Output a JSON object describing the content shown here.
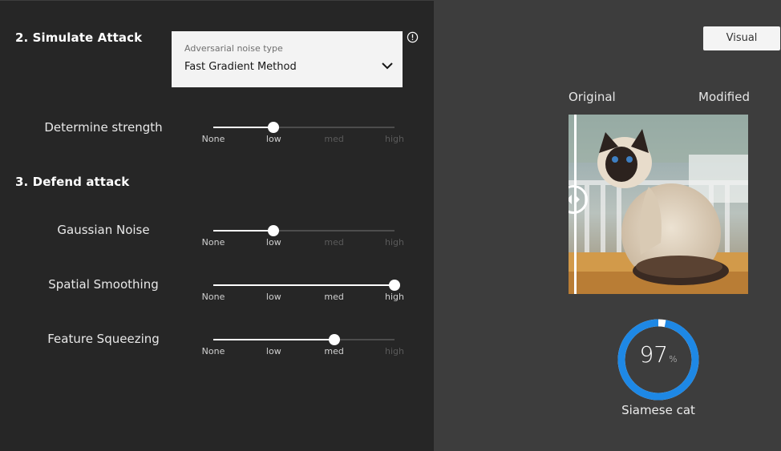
{
  "attack": {
    "title": "2. Simulate Attack",
    "noise_type": {
      "label": "Adversarial noise type",
      "value": "Fast Gradient Method"
    },
    "strength": {
      "label": "Determine strength",
      "level": 1
    }
  },
  "defend": {
    "title": "3. Defend attack",
    "gaussian_noise": {
      "label": "Gaussian Noise",
      "level": 1
    },
    "spatial_smoothing": {
      "label": "Spatial Smoothing",
      "level": 3
    },
    "feature_squeezing": {
      "label": "Feature Squeezing",
      "level": 2
    }
  },
  "slider_ticks": [
    "None",
    "low",
    "med",
    "high"
  ],
  "visual_button": "Visual",
  "comparison": {
    "original_label": "Original",
    "modified_label": "Modified"
  },
  "prediction": {
    "confidence": "97",
    "percent_sign": "%",
    "confidence_fraction": 0.97,
    "class_label": "Siamese cat"
  },
  "colors": {
    "gauge_accent": "#1e88e5",
    "panel_dark": "#262626",
    "panel_right": "#3d3d3d"
  },
  "icons": {
    "dropdown": "chevron-down-icon",
    "info": "info-icon",
    "handle": "compare-handle-icon"
  }
}
